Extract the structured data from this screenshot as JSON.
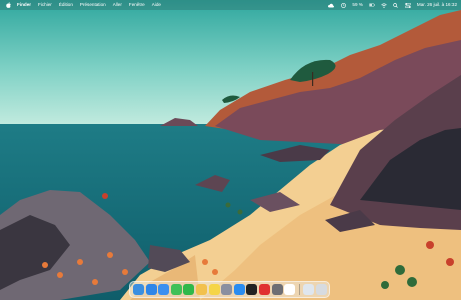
{
  "menubar": {
    "app_name": "Finder",
    "menus": [
      "Fichier",
      "Édition",
      "Présentation",
      "Aller",
      "Fenêtre",
      "Aide"
    ],
    "status": {
      "battery_percent": "59 %",
      "datetime": "Mar. 26 juil. à 16:32"
    }
  },
  "dock": {
    "apps": [
      {
        "icon": "finder-icon",
        "color": "#3b8fe0"
      },
      {
        "icon": "safari-icon",
        "color": "#2f86e8"
      },
      {
        "icon": "mail-icon",
        "color": "#3a8ff0"
      },
      {
        "icon": "messages-icon",
        "color": "#40c057"
      },
      {
        "icon": "facetime-icon",
        "color": "#2fb84a"
      },
      {
        "icon": "photos-icon",
        "color": "#f2c14e"
      },
      {
        "icon": "notes-icon",
        "color": "#f5d547"
      },
      {
        "icon": "launchpad-icon",
        "color": "#8a8fa0"
      },
      {
        "icon": "app-store-icon",
        "color": "#2a8cf0"
      },
      {
        "icon": "terminal-icon",
        "color": "#222222"
      },
      {
        "icon": "screen-recorder-icon",
        "color": "#e03131"
      },
      {
        "icon": "system-preferences-icon",
        "color": "#6e6e73"
      },
      {
        "icon": "calendar-icon",
        "color": "#ffffff"
      },
      {
        "icon": "preview-icon",
        "color": "#dfe6ee"
      },
      {
        "icon": "trash-icon",
        "color": "#d7dbe0"
      }
    ]
  }
}
